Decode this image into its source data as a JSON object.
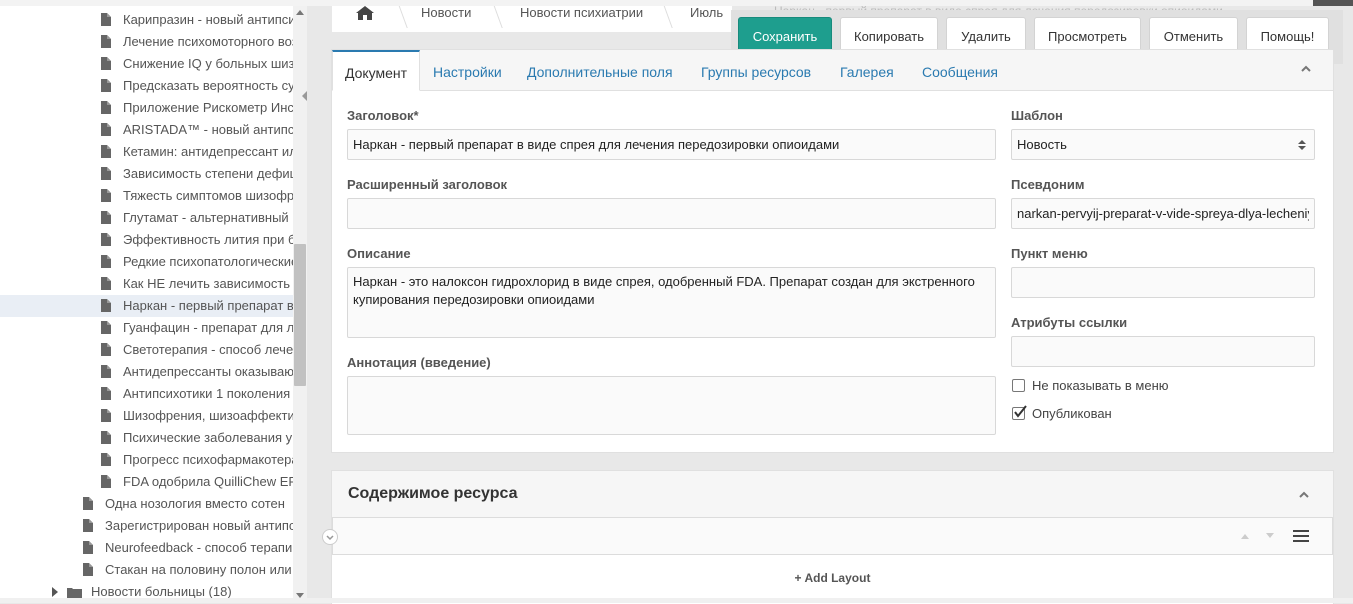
{
  "tree": {
    "items": [
      {
        "label": "Карипразин - новый антипсихотик",
        "type": "doc",
        "level": 2
      },
      {
        "label": "Лечение психомоторного возбуждения",
        "type": "doc",
        "level": 2
      },
      {
        "label": "Снижение IQ у больных шизофренией",
        "type": "doc",
        "level": 2
      },
      {
        "label": "Предсказать вероятность суицида",
        "type": "doc",
        "level": 2
      },
      {
        "label": "Приложение Рискометр Инсульта",
        "type": "doc",
        "level": 2
      },
      {
        "label": "ARISTADA™ - новый антипсихотик",
        "type": "doc",
        "level": 2
      },
      {
        "label": "Кетамин: антидепрессант или",
        "type": "doc",
        "level": 2
      },
      {
        "label": "Зависимость степени дефицита",
        "type": "doc",
        "level": 2
      },
      {
        "label": "Тяжесть симптомов шизофрении",
        "type": "doc",
        "level": 2
      },
      {
        "label": "Глутамат - альтернативный",
        "type": "doc",
        "level": 2
      },
      {
        "label": "Эффективность лития при биполярном",
        "type": "doc",
        "level": 2
      },
      {
        "label": "Редкие психопатологические",
        "type": "doc",
        "level": 2
      },
      {
        "label": "Как НЕ лечить зависимость",
        "type": "doc",
        "level": 2
      },
      {
        "label": "Наркан - первый препарат в виде",
        "type": "doc",
        "level": 2,
        "active": true
      },
      {
        "label": "Гуанфацин - препарат для лечения",
        "type": "doc",
        "level": 2
      },
      {
        "label": "Светотерапия - способ лечения",
        "type": "doc",
        "level": 2
      },
      {
        "label": "Антидепрессанты оказывают",
        "type": "doc",
        "level": 2
      },
      {
        "label": "Антипсихотики 1 поколения",
        "type": "doc",
        "level": 2
      },
      {
        "label": "Шизофрения, шизоаффективное",
        "type": "doc",
        "level": 2
      },
      {
        "label": "Психические заболевания у",
        "type": "doc",
        "level": 2
      },
      {
        "label": "Прогресс психофармакотерапии",
        "type": "doc",
        "level": 2
      },
      {
        "label": "FDA одобрила QuilliChew ER",
        "type": "doc",
        "level": 2
      },
      {
        "label": "Одна нозология вместо сотен",
        "type": "doc",
        "level": 1
      },
      {
        "label": "Зарегистрирован новый антипсихотик",
        "type": "doc",
        "level": 1
      },
      {
        "label": "Neurofeedback - способ терапии",
        "type": "doc",
        "level": 1
      },
      {
        "label": "Стакан на половину полон или",
        "type": "doc",
        "level": 1
      },
      {
        "label": "Новости больницы (18)",
        "type": "folder",
        "level": 0
      }
    ]
  },
  "breadcrumbs": [
    "Новости",
    "Новости психиатрии",
    "Июль"
  ],
  "ghost_title": "Наркан - первый препарат в виде спрея для лечения передозировки опиоидами",
  "actions": {
    "save": "Сохранить",
    "copy": "Копировать",
    "delete": "Удалить",
    "view": "Просмотреть",
    "cancel": "Отменить",
    "help": "Помощь!"
  },
  "tabs": [
    "Документ",
    "Настройки",
    "Дополнительные поля",
    "Группы ресурсов",
    "Галерея",
    "Сообщения"
  ],
  "form": {
    "title_label": "Заголовок*",
    "title_value": "Наркан - первый препарат в виде спрея для лечения передозировки опиоидами",
    "longtitle_label": "Расширенный заголовок",
    "longtitle_value": "",
    "description_label": "Описание",
    "description_value": "Наркан - это налоксон гидрохлорид в виде спрея, одобренный FDA. Препарат создан для экстренного купирования передозировки опиоидами",
    "introtext_label": "Аннотация (введение)",
    "introtext_value": "",
    "template_label": "Шаблон",
    "template_value": "Новость",
    "alias_label": "Псевдоним",
    "alias_value": "narkan-pervyij-preparat-v-vide-spreya-dlya-lecheniya",
    "menutitle_label": "Пункт меню",
    "menutitle_value": "",
    "link_attr_label": "Атрибуты ссылки",
    "link_attr_value": "",
    "hide_menu_label": "Не показывать в меню",
    "hide_menu_checked": false,
    "published_label": "Опубликован",
    "published_checked": true
  },
  "content": {
    "title": "Содержимое ресурса",
    "add_layout": "+ Add Layout"
  },
  "colors": {
    "primary": "#1e9e8e",
    "link": "#2a7ab0"
  }
}
